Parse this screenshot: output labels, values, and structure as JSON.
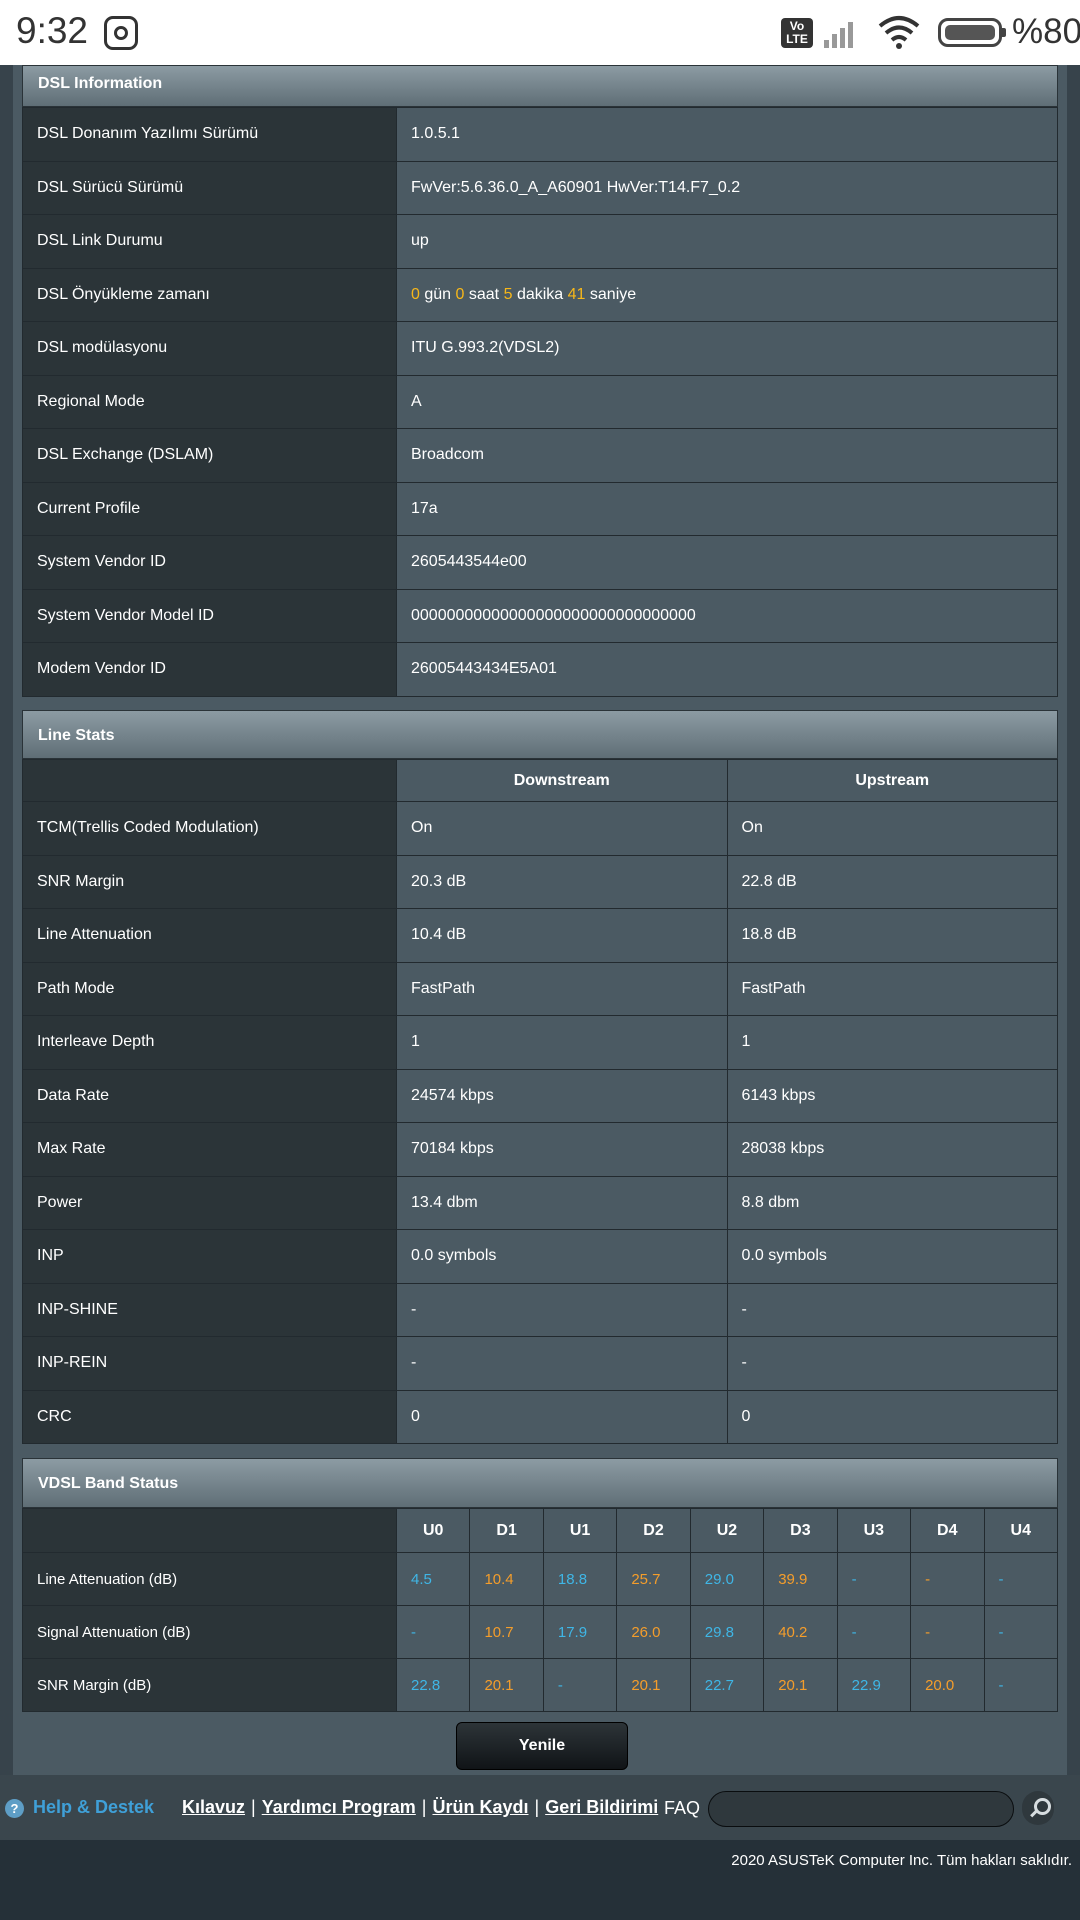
{
  "status_bar": {
    "time": "9:32",
    "volte": "Vo LTE",
    "battery": "%80"
  },
  "dsl_info": {
    "title": "DSL Information",
    "rows": [
      {
        "label": "DSL Donanım Yazılımı Sürümü",
        "value": "1.0.5.1"
      },
      {
        "label": "DSL Sürücü Sürümü",
        "value": "FwVer:5.6.36.0_A_A60901 HwVer:T14.F7_0.2"
      },
      {
        "label": "DSL Link Durumu",
        "value": "up"
      },
      {
        "label": "DSL Önyükleme zamanı",
        "value": ""
      },
      {
        "label": "DSL modülasyonu",
        "value": "ITU G.993.2(VDSL2)"
      },
      {
        "label": "Regional Mode",
        "value": "A"
      },
      {
        "label": "DSL Exchange (DSLAM)",
        "value": "Broadcom"
      },
      {
        "label": "Current Profile",
        "value": "17a"
      },
      {
        "label": "System Vendor ID",
        "value": "2605443544e00"
      },
      {
        "label": "System Vendor Model ID",
        "value": "00000000000000000000000000000000"
      },
      {
        "label": "Modem Vendor ID",
        "value": "26005443434E5A01"
      }
    ],
    "uptime": {
      "days": "0",
      "days_unit": "gün",
      "hours": "0",
      "hours_unit": "saat",
      "minutes": "5",
      "minutes_unit": "dakika",
      "seconds": "41",
      "seconds_unit": "saniye"
    }
  },
  "line_stats": {
    "title": "Line Stats",
    "headers": [
      "Downstream",
      "Upstream"
    ],
    "rows": [
      {
        "label": "TCM(Trellis Coded Modulation)",
        "down": "On",
        "up": "On"
      },
      {
        "label": "SNR Margin",
        "down": "20.3 dB",
        "up": "22.8 dB"
      },
      {
        "label": "Line Attenuation",
        "down": "10.4 dB",
        "up": "18.8 dB"
      },
      {
        "label": "Path Mode",
        "down": "FastPath",
        "up": "FastPath"
      },
      {
        "label": "Interleave Depth",
        "down": "1",
        "up": "1"
      },
      {
        "label": "Data Rate",
        "down": "24574 kbps",
        "up": "6143 kbps"
      },
      {
        "label": "Max Rate",
        "down": "70184 kbps",
        "up": "28038 kbps"
      },
      {
        "label": "Power",
        "down": "13.4 dbm",
        "up": "8.8 dbm"
      },
      {
        "label": "INP",
        "down": "0.0 symbols",
        "up": "0.0 symbols"
      },
      {
        "label": "INP-SHINE",
        "down": "-",
        "up": "-"
      },
      {
        "label": "INP-REIN",
        "down": "-",
        "up": "-"
      },
      {
        "label": "CRC",
        "down": "0",
        "up": "0"
      }
    ]
  },
  "vdsl_band": {
    "title": "VDSL Band Status",
    "bands": [
      "U0",
      "D1",
      "U1",
      "D2",
      "U2",
      "D3",
      "U3",
      "D4",
      "U4"
    ],
    "rows": [
      {
        "label": "Line Attenuation (dB)",
        "values": [
          "4.5",
          "10.4",
          "18.8",
          "25.7",
          "29.0",
          "39.9",
          "-",
          "-",
          "-"
        ]
      },
      {
        "label": "Signal Attenuation (dB)",
        "values": [
          "-",
          "10.7",
          "17.9",
          "26.0",
          "29.8",
          "40.2",
          "-",
          "-",
          "-"
        ]
      },
      {
        "label": "SNR Margin (dB)",
        "values": [
          "22.8",
          "20.1",
          "-",
          "20.1",
          "22.7",
          "20.1",
          "22.9",
          "20.0",
          "-"
        ]
      }
    ],
    "colors": {
      "upstream": "#3fb6e6",
      "downstream": "#f49d2b"
    }
  },
  "refresh_button": "Yenile",
  "footer": {
    "help": "Help & Destek",
    "links": [
      "Kılavuz",
      "Yardımcı Program",
      "Ürün Kaydı",
      "Geri Bildirimi"
    ],
    "separator": "|",
    "faq": "FAQ",
    "search_placeholder": "",
    "copyright": "2020 ASUSTeK Computer Inc. Tüm hakları saklıdır."
  }
}
